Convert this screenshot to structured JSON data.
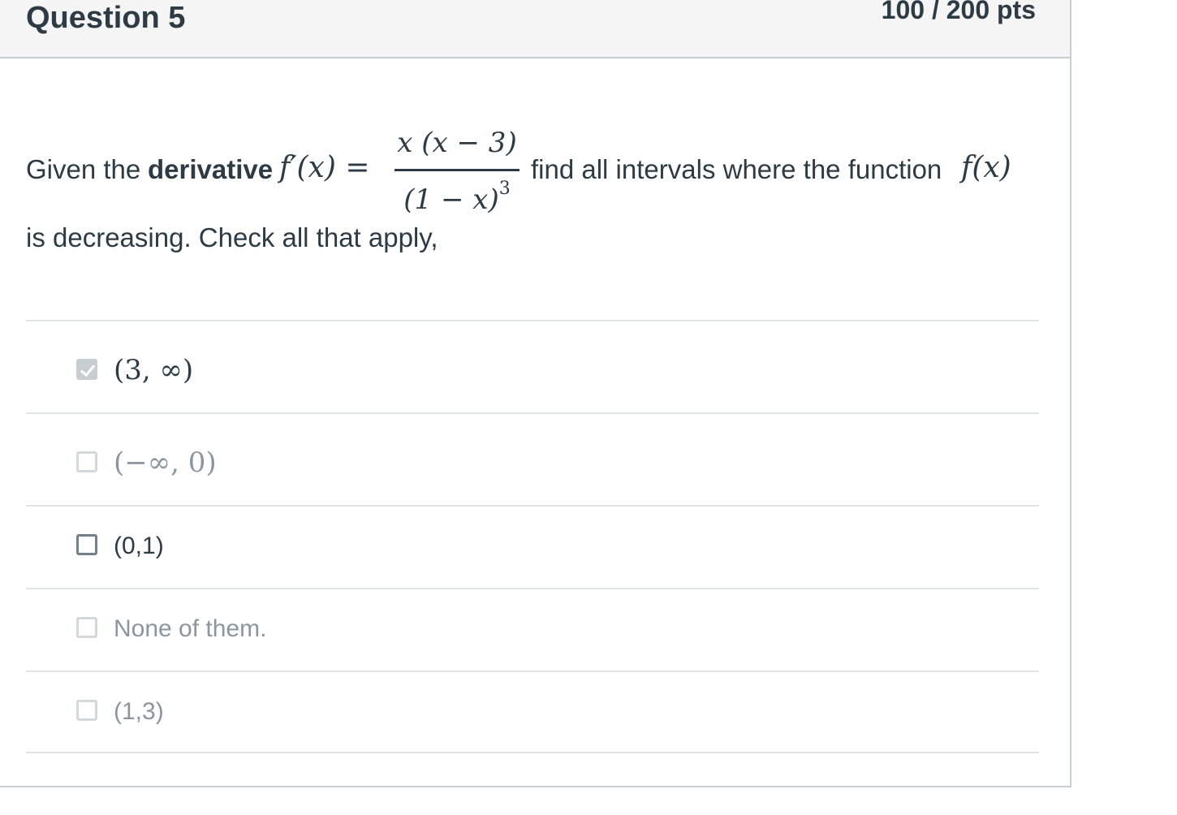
{
  "header": {
    "title": "Question 5",
    "points": "100 / 200 pts"
  },
  "question": {
    "given": "Given the",
    "derivative_word": "derivative",
    "fprime": "f′(x) =",
    "numerator": "x (x − 3)",
    "denominator": "(1 − x)",
    "denominator_exponent": "3",
    "find_text": "find all intervals where the function",
    "fx": "f(x)",
    "line2": "is decreasing.  Check all that apply,"
  },
  "answers": [
    {
      "label": "(3, ∞)",
      "checked": true
    },
    {
      "label": "(−∞, 0)",
      "checked": false
    },
    {
      "label": "(0,1)",
      "checked": false
    },
    {
      "label": "None of them.",
      "checked": false
    },
    {
      "label": "(1,3)",
      "checked": false
    }
  ],
  "colors": {
    "correct_arrow": "#4caf50",
    "text": "#2d3b45",
    "muted": "#8b969e",
    "border": "#c7cdd1"
  }
}
